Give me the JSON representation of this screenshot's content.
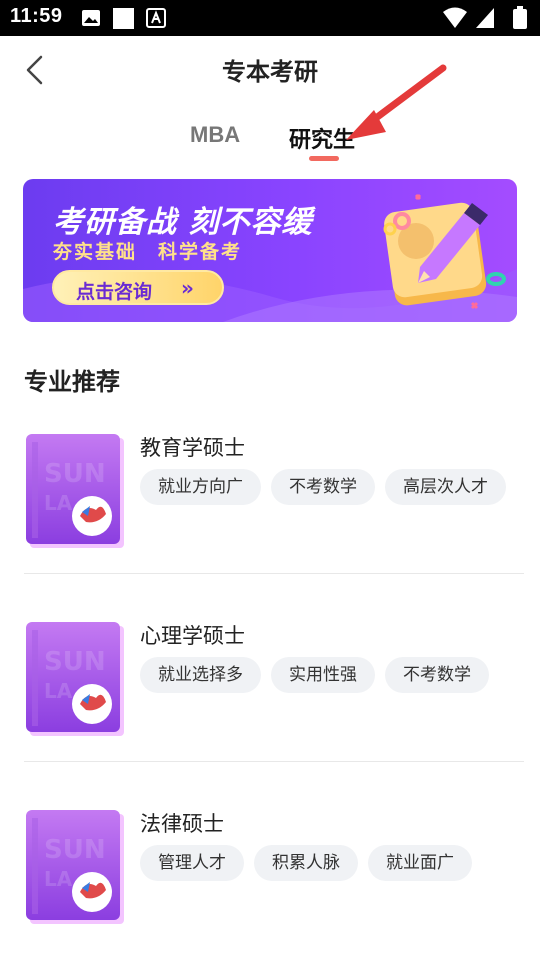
{
  "status_bar": {
    "time": "11:59",
    "left_icons": [
      "image-icon",
      "square-icon",
      "font-a-icon"
    ],
    "right_icons": [
      "wifi-icon",
      "signal-icon",
      "battery-icon"
    ]
  },
  "header": {
    "title": "专本考研",
    "back_icon": "chevron-left-icon"
  },
  "tabs": [
    {
      "label": "MBA",
      "selected": false
    },
    {
      "label": "研究生",
      "selected": true
    }
  ],
  "banner": {
    "title": "考研备战 刻不容缓",
    "subtitle": "夯实基础　科学备考",
    "button_label": "点击咨询",
    "button_arrow": "»"
  },
  "section": {
    "title": "专业推荐"
  },
  "programs": [
    {
      "title": "教育学硕士",
      "tags": [
        "就业方向广",
        "不考数学",
        "高层次人才"
      ]
    },
    {
      "title": "心理学硕士",
      "tags": [
        "就业选择多",
        "实用性强",
        "不考数学"
      ]
    },
    {
      "title": "法律硕士",
      "tags": [
        "管理人才",
        "积累人脉",
        "就业面广"
      ]
    }
  ],
  "colors": {
    "accent": "#f2695f",
    "banner_purple": "#7a40f5",
    "annotation_arrow": "#e43a3a",
    "tag_bg": "#f0f2f5"
  }
}
